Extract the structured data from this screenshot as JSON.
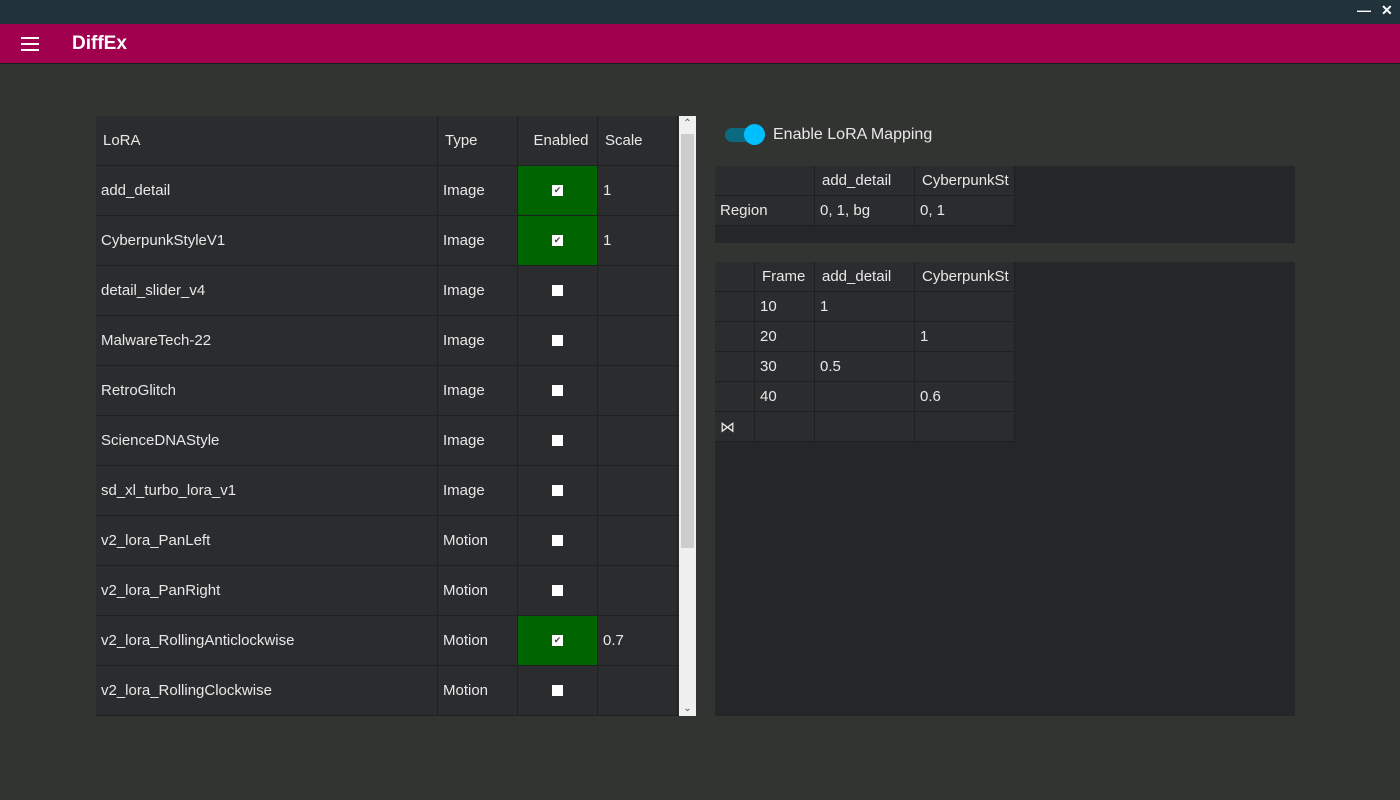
{
  "window": {
    "minimize": "—",
    "close": "✕"
  },
  "app": {
    "title": "DiffEx",
    "menu_icon": "hamburger-icon"
  },
  "lora_table": {
    "headers": [
      "LoRA",
      "Type",
      "Enabled",
      "Scale"
    ],
    "rows": [
      {
        "name": "add_detail",
        "type": "Image",
        "enabled": true,
        "scale": "1"
      },
      {
        "name": "CyberpunkStyleV1",
        "type": "Image",
        "enabled": true,
        "scale": "1"
      },
      {
        "name": "detail_slider_v4",
        "type": "Image",
        "enabled": false,
        "scale": ""
      },
      {
        "name": "MalwareTech-22",
        "type": "Image",
        "enabled": false,
        "scale": ""
      },
      {
        "name": "RetroGlitch",
        "type": "Image",
        "enabled": false,
        "scale": ""
      },
      {
        "name": "ScienceDNAStyle",
        "type": "Image",
        "enabled": false,
        "scale": ""
      },
      {
        "name": "sd_xl_turbo_lora_v1",
        "type": "Image",
        "enabled": false,
        "scale": ""
      },
      {
        "name": "v2_lora_PanLeft",
        "type": "Motion",
        "enabled": false,
        "scale": ""
      },
      {
        "name": "v2_lora_PanRight",
        "type": "Motion",
        "enabled": false,
        "scale": ""
      },
      {
        "name": "v2_lora_RollingAnticlockwise",
        "type": "Motion",
        "enabled": true,
        "scale": "0.7"
      },
      {
        "name": "v2_lora_RollingClockwise",
        "type": "Motion",
        "enabled": false,
        "scale": ""
      }
    ],
    "enabled_color": "#006400"
  },
  "mapping": {
    "toggle_label": "Enable LoRA Mapping",
    "enabled": true
  },
  "region_table": {
    "headers": [
      "",
      "add_detail",
      "CyberpunkSt"
    ],
    "rows": [
      [
        "Region",
        "0, 1, bg",
        "0, 1"
      ]
    ]
  },
  "frame_table": {
    "headers": [
      "",
      "Frame",
      "add_detail",
      "CyberpunkSt"
    ],
    "rows": [
      [
        "",
        "10",
        "1",
        ""
      ],
      [
        "",
        "20",
        "",
        "1"
      ],
      [
        "",
        "30",
        "0.5",
        ""
      ],
      [
        "",
        "40",
        "",
        "0.6"
      ],
      [
        "⋈",
        "",
        "",
        ""
      ]
    ]
  }
}
